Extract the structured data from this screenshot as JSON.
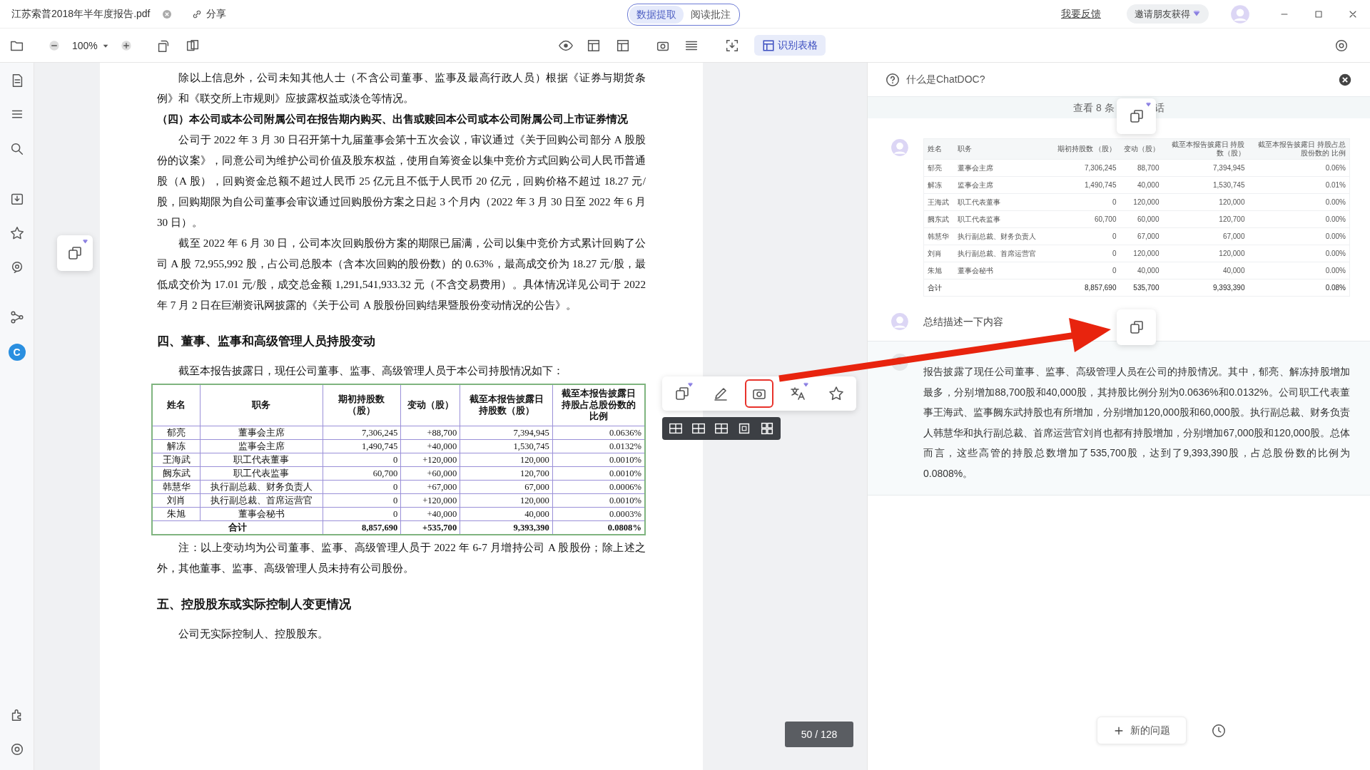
{
  "window": {
    "file_title": "江苏索普2018年半年度报告.pdf",
    "share": "分享",
    "mode_tabs": [
      {
        "label": "数据提取",
        "selected": true
      },
      {
        "label": "阅读批注",
        "selected": false
      }
    ],
    "feedback": "我要反馈",
    "invite": "邀请朋友获得"
  },
  "toolbar": {
    "zoom": "100%",
    "recognize_table": "识别表格"
  },
  "rail": {
    "logo_letter": "C"
  },
  "document": {
    "blocks": [
      {
        "kind": "para",
        "text": "除以上信息外，公司未知其他人士（不含公司董事、监事及最高行政人员）根据《证券与期货条例》和《联交所上市规则》应披露权益或淡仓等情况。"
      },
      {
        "kind": "subheading",
        "text": "（四）本公司或本公司附属公司在报告期内购买、出售或赎回本公司或本公司附属公司上市证券情况"
      },
      {
        "kind": "para",
        "text": "公司于 2022 年 3 月 30 日召开第十九届董事会第十五次会议，审议通过《关于回购公司部分 A 股股份的议案》，同意公司为维护公司价值及股东权益，使用自筹资金以集中竞价方式回购公司人民币普通股（A 股），回购资金总额不超过人民币 25 亿元且不低于人民币 20 亿元，回购价格不超过 18.27 元/股，回购期限为自公司董事会审议通过回购股份方案之日起 3 个月内（2022 年 3 月 30 日至 2022 年 6 月 30 日）。"
      },
      {
        "kind": "para",
        "text": "截至 2022 年 6 月 30 日，公司本次回购股份方案的期限已届满，公司以集中竞价方式累计回购了公司 A 股 72,955,992 股，占公司总股本（含本次回购的股份数）的 0.63%，最高成交价为 18.27 元/股，最低成交价为 17.01 元/股，成交总金额 1,291,541,933.32 元（不含交易费用）。具体情况详见公司于 2022 年 7 月 2 日在巨潮资讯网披露的《关于公司 A 股股份回购结果暨股份变动情况的公告》。"
      },
      {
        "kind": "heading",
        "text": "四、董事、监事和高级管理人员持股变动"
      },
      {
        "kind": "para",
        "text": "截至本报告披露日，现任公司董事、监事、高级管理人员于本公司持股情况如下："
      },
      {
        "kind": "table",
        "columns": [
          "姓名",
          "职务",
          "期初持股数（股）",
          "变动（股）",
          "截至本报告披露日持股数（股）",
          "截至本报告披露日持股占总股份数的比例"
        ],
        "rows": [
          {
            "kind": "row",
            "cells": [
              "郁亮",
              "董事会主席",
              "7,306,245",
              "+88,700",
              "7,394,945",
              "0.0636%"
            ]
          },
          {
            "kind": "row",
            "cells": [
              "解冻",
              "监事会主席",
              "1,490,745",
              "+40,000",
              "1,530,745",
              "0.0132%"
            ]
          },
          {
            "kind": "row",
            "cells": [
              "王海武",
              "职工代表董事",
              "0",
              "+120,000",
              "120,000",
              "0.0010%"
            ]
          },
          {
            "kind": "row",
            "cells": [
              "阙东武",
              "职工代表监事",
              "60,700",
              "+60,000",
              "120,700",
              "0.0010%"
            ]
          },
          {
            "kind": "row",
            "cells": [
              "韩慧华",
              "执行副总裁、财务负责人",
              "0",
              "+67,000",
              "67,000",
              "0.0006%"
            ]
          },
          {
            "kind": "row",
            "cells": [
              "刘肖",
              "执行副总裁、首席运营官",
              "0",
              "+120,000",
              "120,000",
              "0.0010%"
            ]
          },
          {
            "kind": "row",
            "cells": [
              "朱旭",
              "董事会秘书",
              "0",
              "+40,000",
              "40,000",
              "0.0003%"
            ]
          },
          {
            "kind": "total",
            "cells": [
              {
                "text": "合计",
                "colspan": 2
              },
              {
                "text": "8,857,690"
              },
              {
                "text": "+535,700"
              },
              {
                "text": "9,393,390"
              },
              {
                "text": "0.0808%"
              }
            ]
          }
        ]
      },
      {
        "kind": "para",
        "text": "注：以上变动均为公司董事、监事、高级管理人员于 2022 年 6-7 月增持公司 A 股股份；除上述之外，其他董事、监事、高级管理人员未持有公司股份。"
      },
      {
        "kind": "heading",
        "text": "五、控股股东或实际控制人变更情况"
      },
      {
        "kind": "para",
        "text": "公司无实际控制人、控股股东。"
      }
    ]
  },
  "table_tools": [
    {
      "kind": "copy",
      "selected": false,
      "premium": true
    },
    {
      "kind": "edit",
      "selected": false,
      "premium": false
    },
    {
      "kind": "capture",
      "selected": true,
      "premium": false
    },
    {
      "kind": "translate",
      "selected": false,
      "premium": true
    },
    {
      "kind": "star",
      "selected": false,
      "premium": false
    }
  ],
  "page_indicator": "50 / 128",
  "chat": {
    "title": "什么是ChatDOC?",
    "history_banner": [
      "查看 8 条",
      "话"
    ],
    "table": {
      "columns": [
        "姓名",
        "职务",
        "期初持股数 （股）",
        "变动（股）",
        "截至本报告披露日 持股数（股）",
        "截至本报告披露日 持股占总股份数的 比例"
      ],
      "rows": [
        {
          "kind": "row",
          "cells": [
            "郁亮",
            "董事会主席",
            "7,306,245",
            "88,700",
            "7,394,945",
            "0.06%"
          ]
        },
        {
          "kind": "row",
          "cells": [
            "解冻",
            "监事会主席",
            "1,490,745",
            "40,000",
            "1,530,745",
            "0.01%"
          ]
        },
        {
          "kind": "row",
          "cells": [
            "王海武",
            "职工代表董事",
            "0",
            "120,000",
            "120,000",
            "0.00%"
          ]
        },
        {
          "kind": "row",
          "cells": [
            "阙东武",
            "职工代表监事",
            "60,700",
            "60,000",
            "120,700",
            "0.00%"
          ]
        },
        {
          "kind": "row",
          "cells": [
            "韩慧华",
            "执行副总裁、财务负责人",
            "0",
            "67,000",
            "67,000",
            "0.00%"
          ]
        },
        {
          "kind": "row",
          "cells": [
            "刘肖",
            "执行副总裁、首席运营官",
            "0",
            "120,000",
            "120,000",
            "0.00%"
          ]
        },
        {
          "kind": "row",
          "cells": [
            "朱旭",
            "董事会秘书",
            "0",
            "40,000",
            "40,000",
            "0.00%"
          ]
        },
        {
          "kind": "total",
          "cells": [
            "合计",
            "",
            "8,857,690",
            "535,700",
            "9,393,390",
            "0.08%"
          ]
        }
      ]
    },
    "question": "总结描述一下内容",
    "answer": "报告披露了现任公司董事、监事、高级管理人员在公司的持股情况。其中，郁亮、解冻持股增加最多，分别增加88,700股和40,000股，其持股比例分别为0.0636%和0.0132%。公司职工代表董事王海武、监事阙东武持股也有所增加，分别增加120,000股和60,000股。执行副总裁、财务负责人韩慧华和执行副总裁、首席运营官刘肖也都有持股增加，分别增加67,000股和120,000股。总体而言，这些高管的持股总数增加了535,700股，达到了9,393,390股，占总股份数的比例为0.0808%。",
    "new_question": "新的问题"
  }
}
